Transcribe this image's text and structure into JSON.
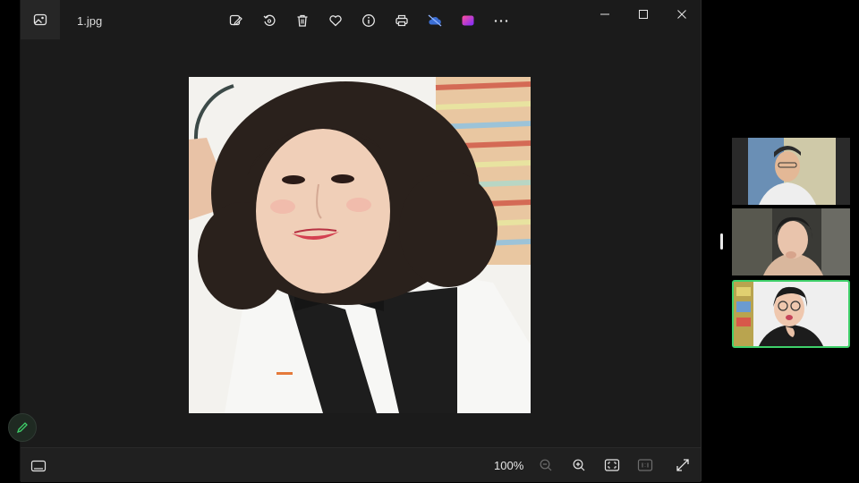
{
  "titlebar": {
    "filename": "1.jpg"
  },
  "toolbar": {
    "buttons": [
      {
        "name": "edit-image-button",
        "icon": "edit-image-icon"
      },
      {
        "name": "rotate-button",
        "icon": "rotate-icon"
      },
      {
        "name": "delete-button",
        "icon": "trash-icon"
      },
      {
        "name": "favorite-button",
        "icon": "heart-icon"
      },
      {
        "name": "file-info-button",
        "icon": "info-icon"
      },
      {
        "name": "print-button",
        "icon": "printer-icon"
      },
      {
        "name": "onedrive-button",
        "icon": "cloud-off-icon"
      },
      {
        "name": "clipchamp-button",
        "icon": "clipchamp-icon"
      },
      {
        "name": "more-button",
        "icon": "more-icon"
      }
    ]
  },
  "window_controls": [
    "minimize",
    "maximize",
    "close"
  ],
  "bottombar": {
    "zoom_level": "100%"
  },
  "colors": {
    "accent_green": "#3fd06a",
    "viewer_bg": "#1b1b1b",
    "bar_bg": "#202020"
  },
  "participants": [
    {
      "tile": "participant-tile-1",
      "speaking": false
    },
    {
      "tile": "participant-tile-2",
      "speaking": false
    },
    {
      "tile": "participant-tile-3",
      "speaking": true
    }
  ]
}
